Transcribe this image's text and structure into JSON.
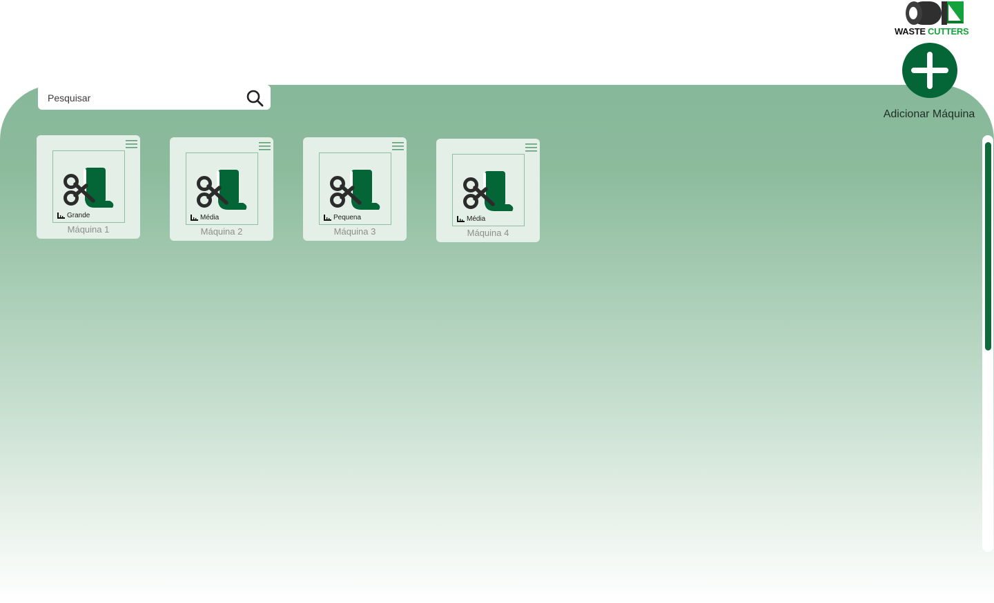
{
  "brand": {
    "name_part1": "WASTE",
    "name_part2": "CUTTERS",
    "accent_color": "#13a23c",
    "logo_icon": "paper-roll-logo-icon"
  },
  "search": {
    "placeholder": "Pesquisar",
    "icon": "search-icon"
  },
  "add_machine": {
    "label": "Adicionar Máquina",
    "icon": "plus-icon",
    "color": "#046537"
  },
  "machines": [
    {
      "name": "Máquina 1",
      "size": "Grande",
      "icon": "scissors-paper-icon"
    },
    {
      "name": "Máquina 2",
      "size": "Média",
      "icon": "scissors-paper-icon"
    },
    {
      "name": "Máquina 3",
      "size": "Pequena",
      "icon": "scissors-paper-icon"
    },
    {
      "name": "Máquina 4",
      "size": "Média",
      "icon": "scissors-paper-icon"
    }
  ],
  "colors": {
    "primary_green": "#046537",
    "card_bg": "#e4efe7",
    "panel_top": "#86b899"
  },
  "scroll": {
    "position_fraction": 0.0,
    "visible_fraction": 0.5
  }
}
